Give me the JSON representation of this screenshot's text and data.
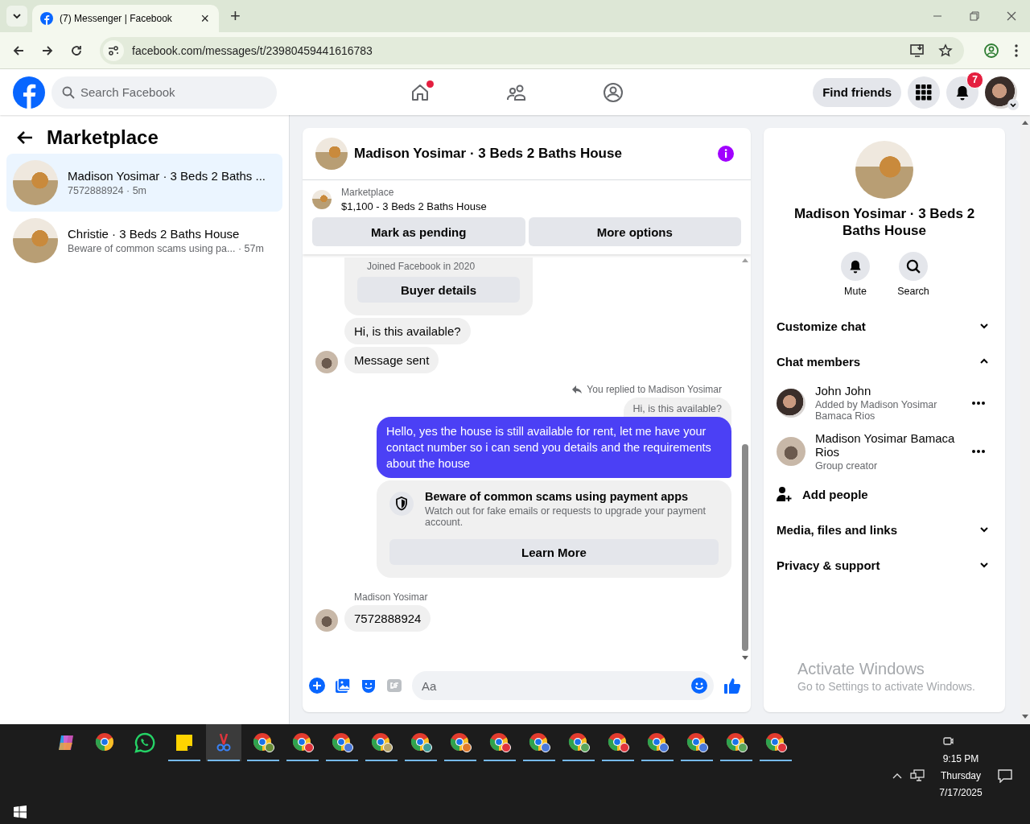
{
  "browser": {
    "tab": {
      "title": "(7) Messenger | Facebook",
      "close": "×"
    },
    "new_tab": "+",
    "url": "facebook.com/messages/t/23980459441616783"
  },
  "header": {
    "search": {
      "placeholder": "Search Facebook"
    },
    "nav": [
      {
        "kind": "home",
        "dot": true
      },
      {
        "kind": "friends",
        "dot": false
      },
      {
        "kind": "groups",
        "dot": false
      }
    ],
    "find_friends": "Find friends",
    "notifications_count": "7"
  },
  "left": {
    "title": "Marketplace",
    "conversations": [
      {
        "title": "Madison Yosimar · 3 Beds 2 Baths ...",
        "subtitle": "7572888924 · 5m",
        "selected": true
      },
      {
        "title": "Christie · 3 Beds 2 Baths House",
        "subtitle": "Beware of common scams using pa...  · 57m",
        "selected": false
      }
    ]
  },
  "chat": {
    "title": "Madison Yosimar · 3 Beds 2 Baths House",
    "listing": {
      "source": "Marketplace",
      "item": "$1,100 - 3 Beds 2 Baths House",
      "buttons": [
        "Mark as pending",
        "More options"
      ]
    },
    "messages": [
      {
        "kind": "buyer-card",
        "text": "Joined Facebook in 2020",
        "button": "Buyer details"
      },
      {
        "kind": "incoming",
        "text": "Hi, is this available?",
        "avatar": false
      },
      {
        "kind": "incoming",
        "text": "Message sent",
        "avatar": true
      },
      {
        "kind": "reply-note",
        "text": "You replied to Madison Yosimar"
      },
      {
        "kind": "quoted",
        "text": "Hi, is this available?"
      },
      {
        "kind": "outgoing",
        "text": "Hello, yes the house is still available for rent, let me have your contact number so i can send you details and the requirements about the house"
      },
      {
        "kind": "warning",
        "title": "Beware of common scams using payment apps",
        "text": "Watch out for fake emails or requests to upgrade your payment account.",
        "button": "Learn More"
      },
      {
        "kind": "sender",
        "text": "Madison Yosimar"
      },
      {
        "kind": "incoming",
        "text": "7572888924",
        "avatar": true
      }
    ],
    "composer": {
      "placeholder": "Aa"
    }
  },
  "details": {
    "title": "Madison Yosimar · 3 Beds 2 Baths House",
    "actions": [
      "Mute",
      "Search"
    ],
    "sections": [
      {
        "label": "Customize chat",
        "expanded": false
      },
      {
        "label": "Chat members",
        "expanded": true,
        "members": [
          {
            "name": "John John",
            "note": "Added by Madison Yosimar Bamaca Rios"
          },
          {
            "name": "Madison Yosimar Bamaca Rios",
            "note": "Group creator"
          }
        ],
        "add_label": "Add people"
      },
      {
        "label": "Media, files and links",
        "expanded": false
      },
      {
        "label": "Privacy & support",
        "expanded": false
      }
    ]
  },
  "watermark": {
    "title": "Activate Windows",
    "text": "Go to Settings to activate Windows."
  },
  "taskbar": {
    "apps": [
      {
        "kind": "copilot",
        "running": false,
        "selected": false
      },
      {
        "kind": "chrome",
        "running": false,
        "selected": false
      },
      {
        "kind": "whatsapp",
        "running": false,
        "selected": false
      },
      {
        "kind": "notes",
        "running": true,
        "selected": false
      },
      {
        "kind": "snipping",
        "running": true,
        "selected": true
      },
      {
        "kind": "chrome-profile",
        "running": true,
        "selected": false,
        "color": "#6a8f3a"
      },
      {
        "kind": "chrome-profile",
        "running": true,
        "selected": false,
        "color": "#e0343c"
      },
      {
        "kind": "chrome-profile",
        "running": true,
        "selected": false,
        "color": "#4a78d8"
      },
      {
        "kind": "chrome-profile",
        "running": true,
        "selected": false,
        "color": "#b9a66a"
      },
      {
        "kind": "chrome-profile",
        "running": true,
        "selected": false,
        "color": "#3e9e98"
      },
      {
        "kind": "chrome-profile",
        "running": true,
        "selected": false,
        "color": "#e07a2c"
      },
      {
        "kind": "chrome-profile",
        "running": true,
        "selected": false,
        "color": "#e0343c"
      },
      {
        "kind": "chrome-profile",
        "running": true,
        "selected": false,
        "color": "#4a78d8"
      },
      {
        "kind": "chrome-profile",
        "running": true,
        "selected": false,
        "color": "#5aa65a"
      },
      {
        "kind": "chrome-profile",
        "running": true,
        "selected": false,
        "color": "#e0343c"
      },
      {
        "kind": "chrome-profile",
        "running": true,
        "selected": false,
        "color": "#4a78d8"
      },
      {
        "kind": "chrome-profile",
        "running": true,
        "selected": false,
        "color": "#4a78d8"
      },
      {
        "kind": "chrome-profile",
        "running": true,
        "selected": false,
        "color": "#5aa65a"
      },
      {
        "kind": "chrome-profile",
        "running": true,
        "selected": false,
        "color": "#e0343c"
      }
    ],
    "time": "9:15 PM",
    "day": "Thursday",
    "date": "7/17/2025"
  }
}
